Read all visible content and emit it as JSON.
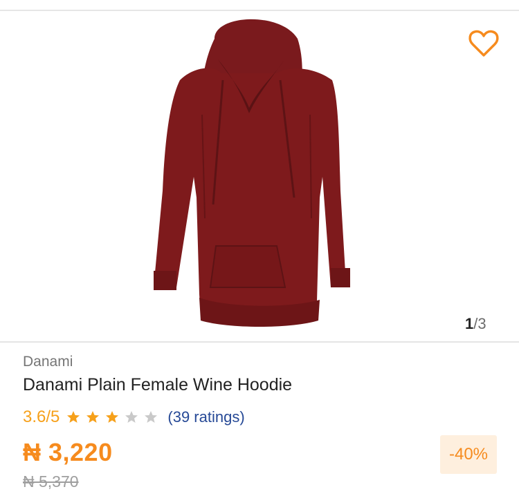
{
  "gallery": {
    "current": "1",
    "separator": "/",
    "total": "3"
  },
  "product": {
    "brand": "Danami",
    "title": "Danami Plain Female Wine Hoodie",
    "rating": {
      "score": "3.6",
      "max": "/5",
      "value": 3.6,
      "ratings_text": "(39 ratings)"
    },
    "price": "₦ 3,220",
    "old_price": "₦ 5,370",
    "discount": "-40%"
  },
  "colors": {
    "accent": "#f68b1e",
    "star_on": "#f6a01a",
    "star_off": "#c9c9c9",
    "link": "#264996",
    "hoodie": "#7e1a1c"
  },
  "icons": {
    "wishlist": "heart-outline-icon",
    "rating_star": "star-icon"
  }
}
